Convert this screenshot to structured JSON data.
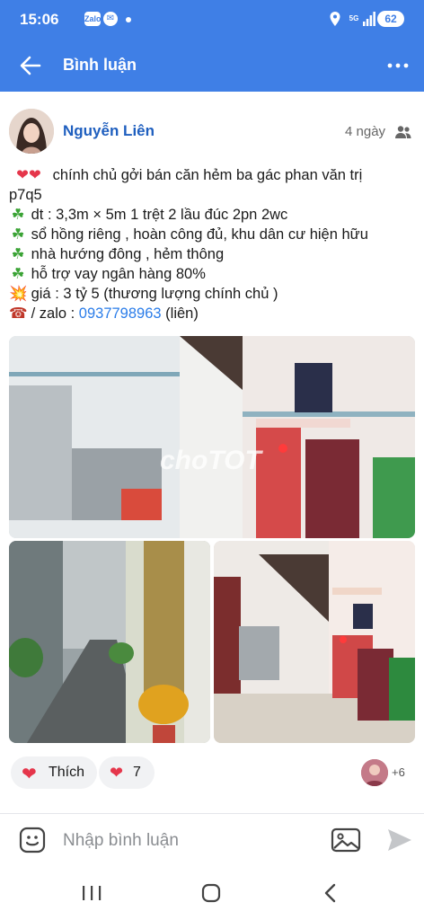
{
  "status_bar": {
    "time": "15:06",
    "zalo_icon": "Zalo",
    "network": "5G",
    "battery": "62"
  },
  "app_bar": {
    "title": "Bình luận"
  },
  "post": {
    "author": "Nguyễn Liên",
    "time_ago": "4 ngày",
    "lines": [
      {
        "emoji": "❤❤",
        "text": "chính chủ gởi bán căn hẻm ba gác phan văn trị"
      },
      {
        "emoji": "",
        "text": "p7q5"
      },
      {
        "emoji": "☘",
        "text": "dt : 3,3m × 5m 1 trệt 2 lầu đúc 2pn 2wc"
      },
      {
        "emoji": "☘",
        "text": "sổ hồng riêng , hoàn công đủ, khu dân cư hiện hữu"
      },
      {
        "emoji": "☘",
        "text": "nhà hướng đông , hẻm thông"
      },
      {
        "emoji": "☘",
        "text": "hỗ trợ vay ngân hàng 80%"
      },
      {
        "emoji": "💥",
        "text": "giá : 3 tỷ 5 (thương lượng chính chủ )"
      }
    ],
    "contact": {
      "emoji": "☎",
      "prefix": "/ zalo :",
      "phone": "0937798963",
      "suffix": "(liên)"
    },
    "watermark": "choTOT"
  },
  "reactions": {
    "like_label": "Thích",
    "count": "7",
    "more_reactors": "+6"
  },
  "composer": {
    "placeholder": "Nhập bình luận"
  },
  "colors": {
    "brand_blue": "#3f7fe6",
    "author_blue": "#1f5fbf",
    "heart_red": "#e5364b",
    "link_blue": "#2b7de9"
  },
  "icons": {
    "back": "arrow-left-icon",
    "more": "more-horizontal-icon",
    "audience": "friends-icon",
    "sticker": "sticker-icon",
    "image": "image-icon",
    "send": "send-icon"
  }
}
